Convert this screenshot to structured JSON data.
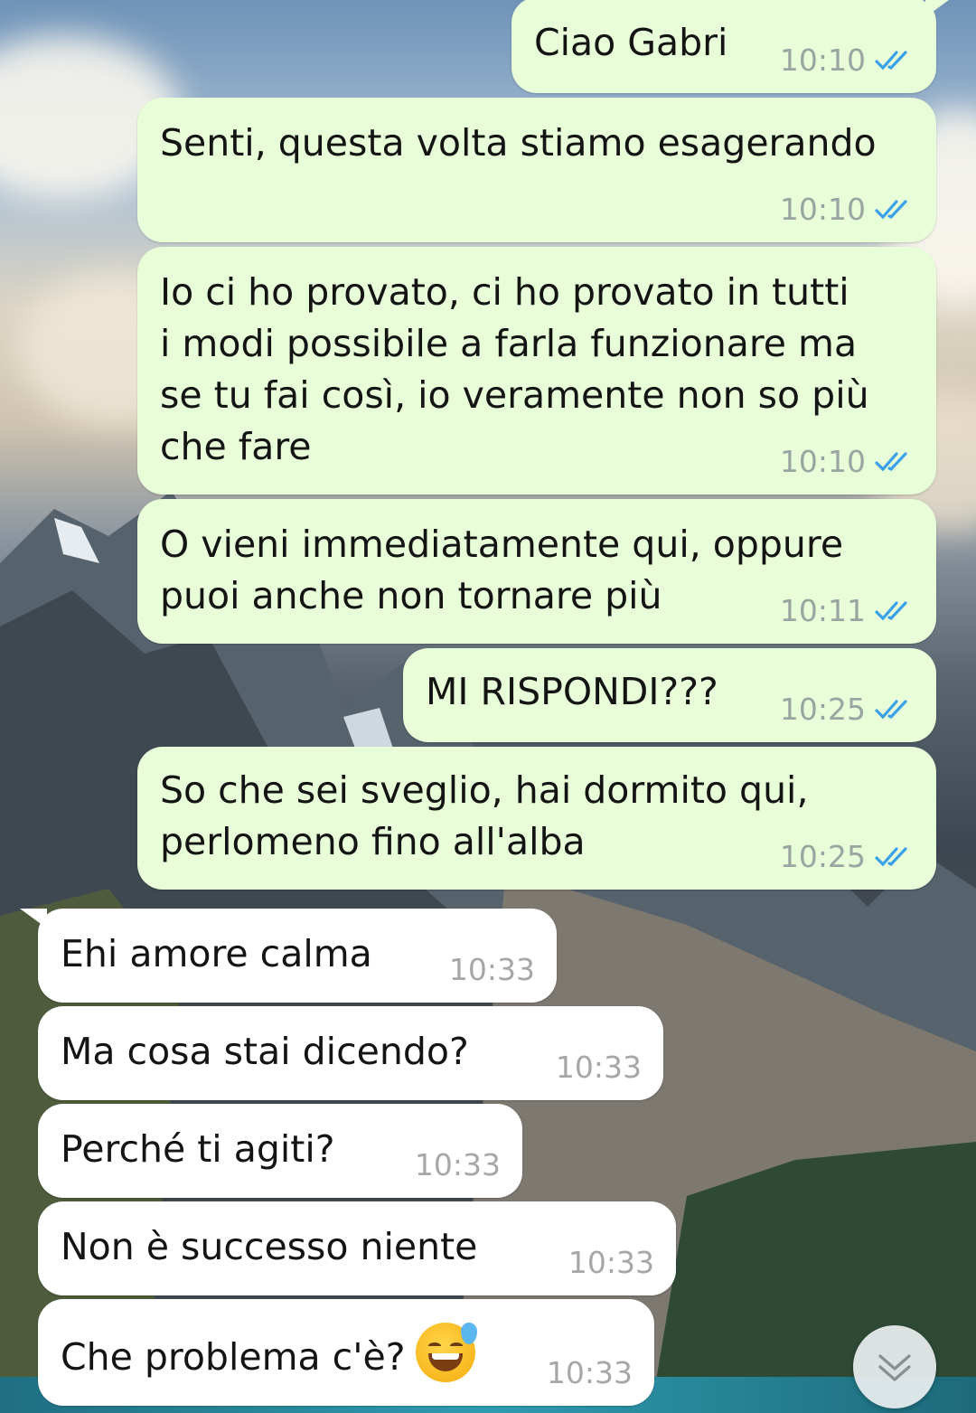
{
  "chat": {
    "messages": [
      {
        "direction": "outgoing",
        "lines": [
          "Ciao Gabri"
        ],
        "time": "10:10",
        "status": "read"
      },
      {
        "direction": "outgoing",
        "lines": [
          "Senti, questa volta stiamo esagerando"
        ],
        "time": "10:10",
        "status": "read"
      },
      {
        "direction": "outgoing",
        "lines": [
          "Io ci ho provato, ci ho provato in tutti",
          "i modi possibile a farla funzionare ma",
          "se tu fai così, io veramente non so più",
          "che fare"
        ],
        "time": "10:10",
        "status": "read"
      },
      {
        "direction": "outgoing",
        "lines": [
          "O vieni immediatamente qui, oppure",
          "puoi anche non tornare più"
        ],
        "time": "10:11",
        "status": "read"
      },
      {
        "direction": "outgoing",
        "lines": [
          "MI RISPONDI???"
        ],
        "time": "10:25",
        "status": "read"
      },
      {
        "direction": "outgoing",
        "lines": [
          "So che sei sveglio, hai dormito qui,",
          "perlomeno fino all'alba"
        ],
        "time": "10:25",
        "status": "read"
      },
      {
        "direction": "incoming",
        "lines": [
          "Ehi amore calma"
        ],
        "time": "10:33"
      },
      {
        "direction": "incoming",
        "lines": [
          "Ma cosa stai dicendo?"
        ],
        "time": "10:33"
      },
      {
        "direction": "incoming",
        "lines": [
          "Perché ti agiti?"
        ],
        "time": "10:33"
      },
      {
        "direction": "incoming",
        "lines": [
          "Non è successo niente"
        ],
        "time": "10:33"
      },
      {
        "direction": "incoming",
        "lines": [
          "Che problema c'è?"
        ],
        "time": "10:33",
        "emoji": "grinning-face-with-sweat"
      }
    ]
  },
  "colors": {
    "outgoing_bubble": "#e7fed8",
    "incoming_bubble": "#ffffff",
    "read_ticks": "#3aa0e8",
    "timestamp": "#9aa4a0"
  },
  "icons": {
    "read_receipt": "double-check-icon",
    "scroll_down": "chevron-double-down-icon"
  }
}
